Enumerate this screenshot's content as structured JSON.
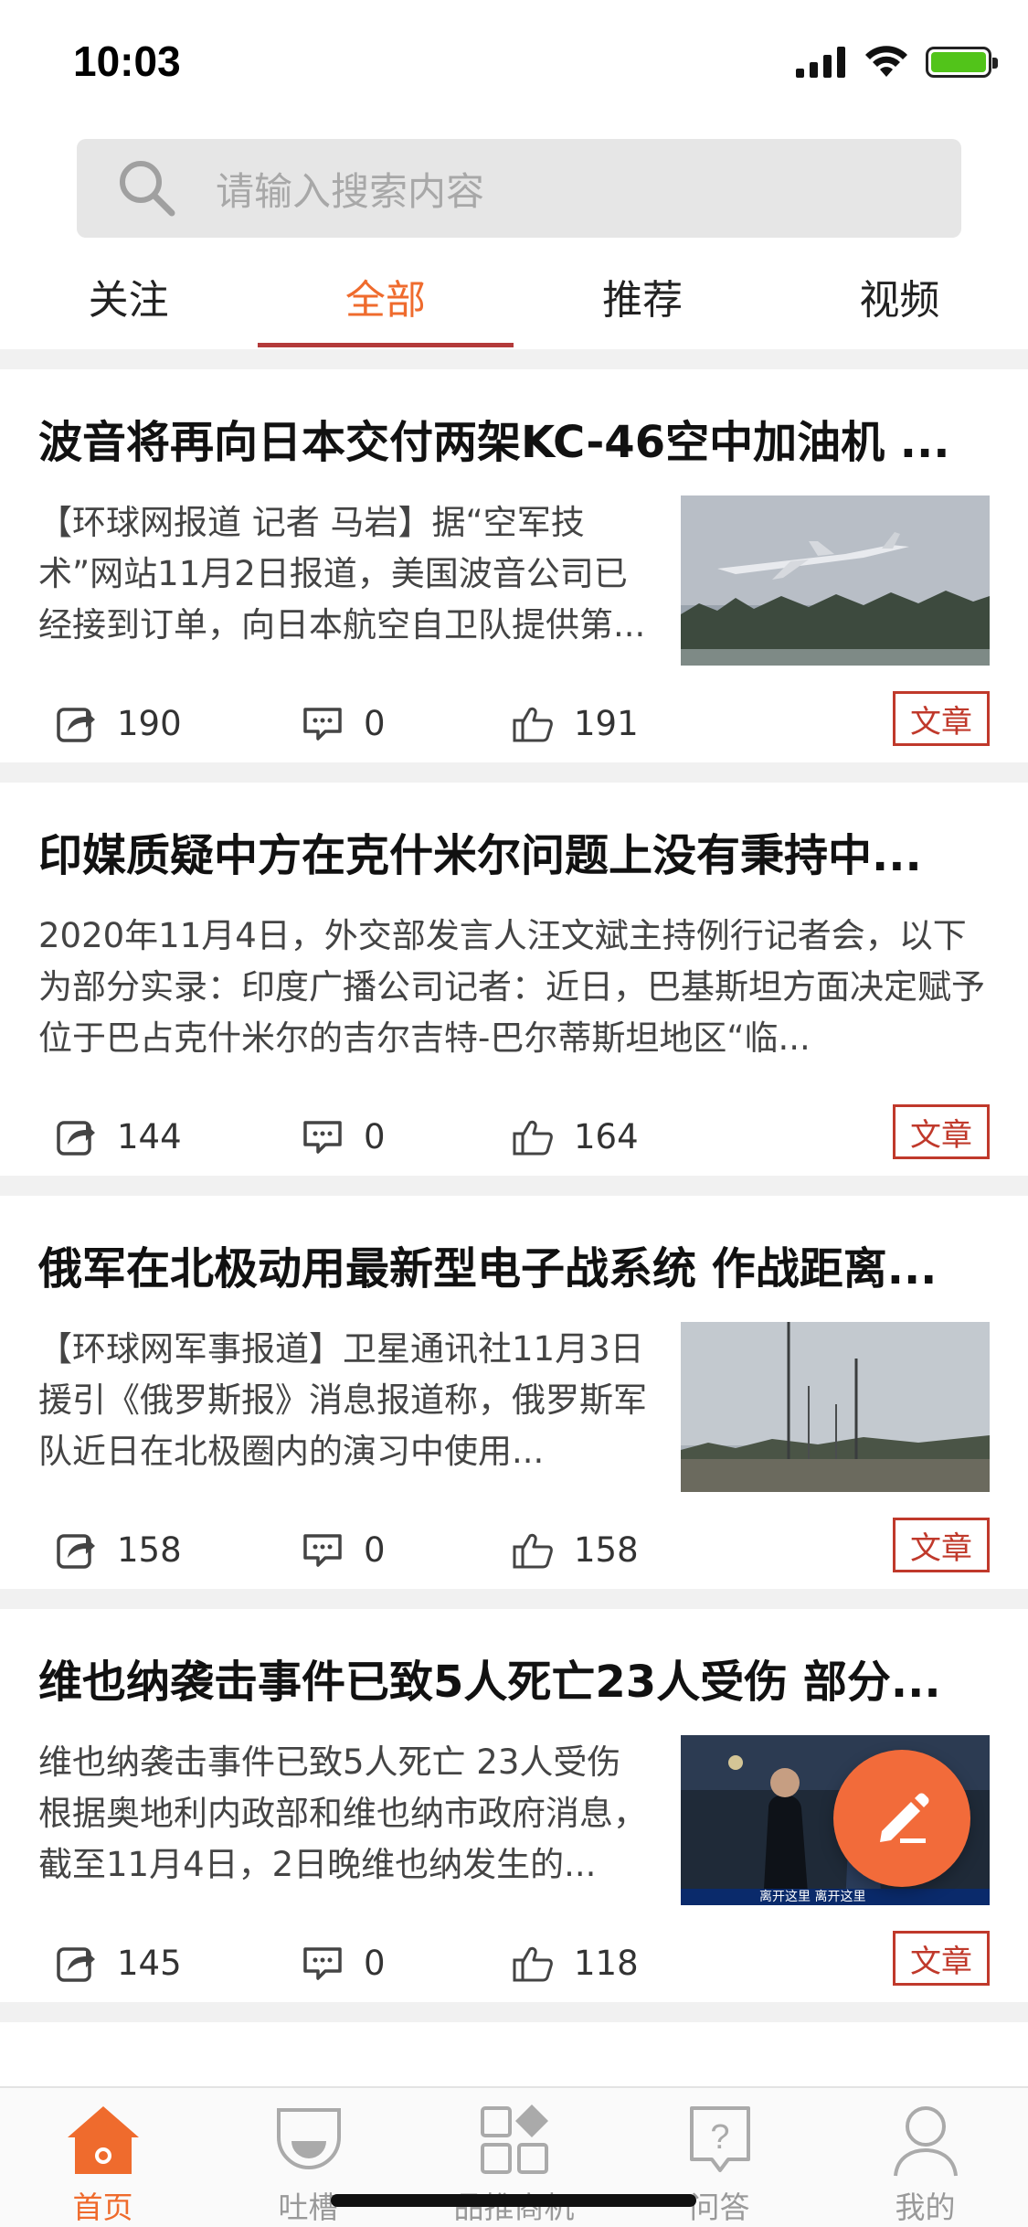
{
  "status_bar": {
    "time": "10:03"
  },
  "search": {
    "placeholder": "请输入搜索内容"
  },
  "tabs": [
    {
      "label": "关注",
      "active": false
    },
    {
      "label": "全部",
      "active": true
    },
    {
      "label": "推荐",
      "active": false
    },
    {
      "label": "视频",
      "active": false
    }
  ],
  "articles": [
    {
      "title": "波音将再向日本交付两架KC-46空中加油机 ...",
      "summary": "【环球网报道 记者 马岩】据“空军技术”网站11月2日报道，美国波音公司已经接到订单，向日本航空自卫队提供第...",
      "has_thumbnail": true,
      "thumbnail": "airplane-takeoff",
      "shares": "190",
      "comments": "0",
      "likes": "191",
      "tag": "文章"
    },
    {
      "title": "印媒质疑中方在克什米尔问题上没有秉持中...",
      "summary": "2020年11月4日，外交部发言人汪文斌主持例行记者会，以下为部分实录：印度广播公司记者：近日，巴基斯坦方面决定赋予位于巴占克什米尔的吉尔吉特-巴尔蒂斯坦地区“临...",
      "has_thumbnail": false,
      "shares": "144",
      "comments": "0",
      "likes": "164",
      "tag": "文章"
    },
    {
      "title": "俄军在北极动用最新型电子战系统 作战距离...",
      "summary": "【环球网军事报道】卫星通讯社11月3日援引《俄罗斯报》消息报道称，俄罗斯军队近日在北极圈内的演习中使用...",
      "has_thumbnail": true,
      "thumbnail": "antenna-towers",
      "shares": "158",
      "comments": "0",
      "likes": "158",
      "tag": "文章"
    },
    {
      "title": "维也纳袭击事件已致5人死亡23人受伤 部分...",
      "summary": "维也纳袭击事件已致5人死亡 23人受伤根据奥地利内政部和维也纳市政府消息，截至11月4日，2日晚维也纳发生的...",
      "has_thumbnail": true,
      "thumbnail": "news-broadcast",
      "thumbnail_caption": "离开这里 离开这里",
      "shares": "145",
      "comments": "0",
      "likes": "118",
      "tag": "文章"
    }
  ],
  "bottom_nav": [
    {
      "label": "首页",
      "icon": "home-icon",
      "active": true
    },
    {
      "label": "吐槽",
      "icon": "chat-bubble-icon",
      "active": false
    },
    {
      "label": "品推商机",
      "icon": "grid-diamond-icon",
      "active": false
    },
    {
      "label": "问答",
      "icon": "question-icon",
      "active": false
    },
    {
      "label": "我的",
      "icon": "profile-icon",
      "active": false
    }
  ],
  "colors": {
    "accent": "#ef6b2d",
    "tab_underline": "#b33a3a",
    "tag_border": "#c0392b",
    "fab": "#f26b3a"
  }
}
